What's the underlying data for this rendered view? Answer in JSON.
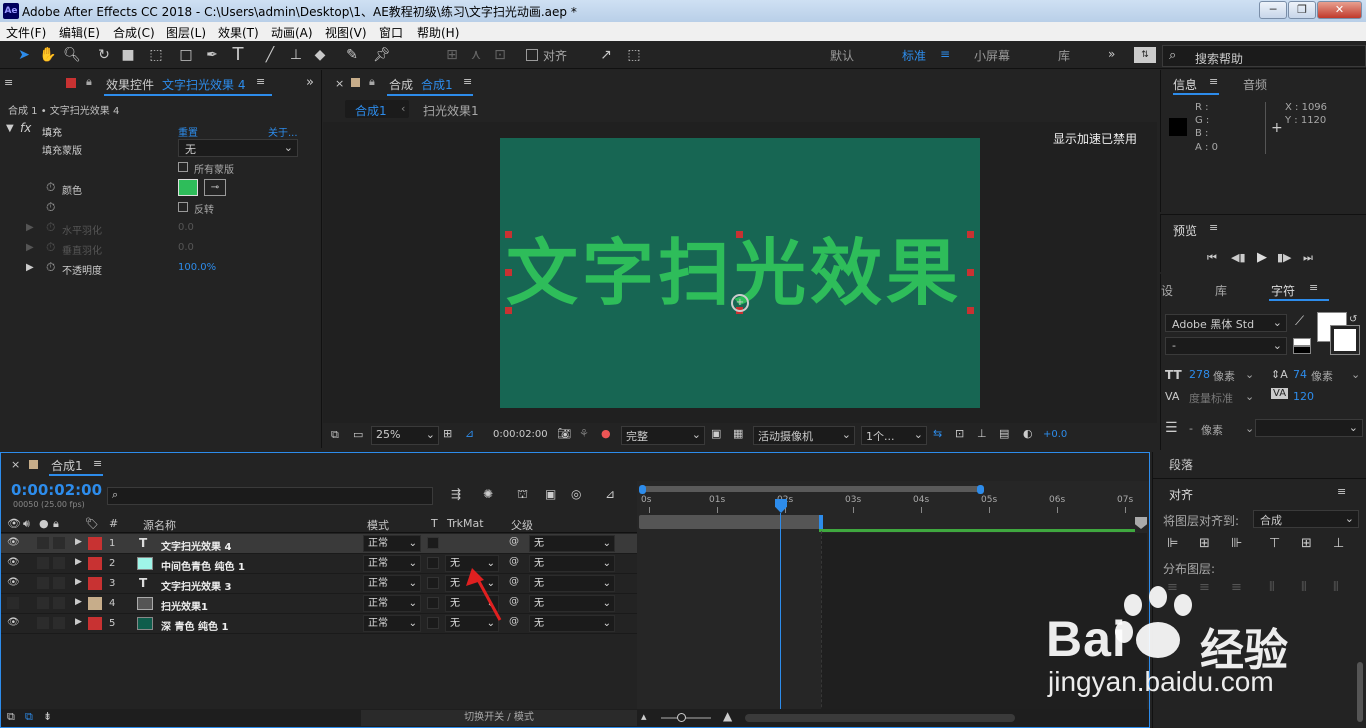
{
  "app": {
    "title": "Adobe After Effects CC 2018 - C:\\Users\\admin\\Desktop\\1、AE教程初级\\练习\\文字扫光动画.aep *",
    "logo": "Ae",
    "win_min": "─",
    "win_max": "❐",
    "win_close": "✕"
  },
  "menu": [
    "文件(F)",
    "编辑(E)",
    "合成(C)",
    "图层(L)",
    "效果(T)",
    "动画(A)",
    "视图(V)",
    "窗口",
    "帮助(H)"
  ],
  "toolbar": {
    "snap_label": "对齐",
    "workspaces": [
      "默认",
      "标准",
      "小屏幕",
      "库"
    ],
    "active_workspace": "标准",
    "search_placeholder": "搜索帮助"
  },
  "effects_panel": {
    "tab_label": "效果控件",
    "tab_layer": "文字扫光效果 4",
    "breadcrumb": "合成 1 • 文字扫光效果 4",
    "effect_name": "填充",
    "reset": "重置",
    "about": "关于...",
    "rows": [
      {
        "label": "填充蒙版",
        "value": "无"
      },
      {
        "label": "",
        "value": "所有蒙版"
      },
      {
        "label": "颜色",
        "value": ""
      },
      {
        "label": "",
        "value": "反转"
      },
      {
        "label": "水平羽化",
        "value": "0.0"
      },
      {
        "label": "垂直羽化",
        "value": "0.0"
      },
      {
        "label": "不透明度",
        "value": "100.0%"
      }
    ],
    "fill_color": "#2ebd5a"
  },
  "comp_panel": {
    "tab_label": "合成",
    "tab_name": "合成1",
    "crumbs": [
      "合成1",
      "扫光效果1"
    ],
    "accel_notice": "显示加速已禁用",
    "canvas_text": "文字扫光效果",
    "canvas_bg": "#176653",
    "text_color": "#2ebd5a",
    "footer": {
      "zoom": "25%",
      "timecode": "0:00:02:00",
      "quality": "完整",
      "camera": "活动摄像机",
      "views": "1个...",
      "exposure": "+0.0"
    }
  },
  "info_panel": {
    "tabs": [
      "信息",
      "音频"
    ],
    "r": "R :",
    "g": "G :",
    "b": "B :",
    "a": "A : 0",
    "x": "X : 1096",
    "y": "Y : 1120"
  },
  "preview_panel": {
    "title": "预览"
  },
  "char_panel": {
    "tabs": [
      "设",
      "库",
      "字符"
    ],
    "font": "Adobe 黑体 Std",
    "style": "-",
    "size": "278",
    "size_unit": "像素",
    "leading": "74",
    "leading_unit": "像素",
    "kerning": "度量标准",
    "tracking": "120",
    "stroke": "-",
    "stroke_unit": "像素"
  },
  "paragraph_panel": {
    "title": "段落"
  },
  "align_panel": {
    "title": "对齐",
    "align_to_label": "将图层对齐到:",
    "align_to_value": "合成",
    "distribute_label": "分布图层:"
  },
  "timeline": {
    "tab_name": "合成1",
    "timecode": "0:00:02:00",
    "frame_info": "00050 (25.00 fps)",
    "search_placeholder": "",
    "columns": {
      "num": "#",
      "source": "源名称",
      "mode": "模式",
      "t": "T",
      "trkmat": "TrkMat",
      "parent": "父级"
    },
    "layers": [
      {
        "num": "1",
        "type": "T",
        "name": "文字扫光效果 4",
        "mode": "正常",
        "trkmat": "",
        "parent": "无",
        "color": "#c83232",
        "bar": "#8e3a3a",
        "selected": true
      },
      {
        "num": "2",
        "type": "solid",
        "name": "中间色青色 纯色 1",
        "mode": "正常",
        "trkmat": "无",
        "parent": "无",
        "color": "#c83232",
        "bar": "#8e3a3a",
        "swatch": "#9ff5e8"
      },
      {
        "num": "3",
        "type": "T",
        "name": "文字扫光效果 3",
        "mode": "正常",
        "trkmat": "无",
        "parent": "无",
        "color": "#c83232",
        "bar": "#8e3a3a"
      },
      {
        "num": "4",
        "type": "comp",
        "name": "扫光效果1",
        "mode": "正常",
        "trkmat": "无",
        "parent": "无",
        "color": "#c7ad8a",
        "bar": "#7e7062"
      },
      {
        "num": "5",
        "type": "solid",
        "name": "深 青色 纯色 1",
        "mode": "正常",
        "trkmat": "无",
        "parent": "无",
        "color": "#c83232",
        "bar": "#8e3a3a",
        "swatch": "#0f5d4c"
      }
    ],
    "ruler": [
      "0s",
      "01s",
      "02s",
      "03s",
      "04s",
      "05s",
      "06s",
      "07s"
    ],
    "footer_label": "切换开关 / 模式"
  },
  "watermark": {
    "brand": "Bai",
    "brand_tail": "经验",
    "url": "jingyan.baidu.com"
  }
}
